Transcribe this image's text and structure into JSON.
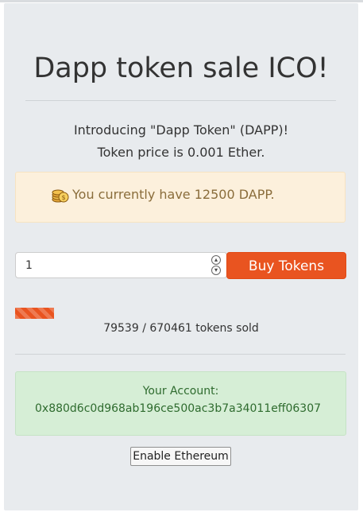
{
  "header": {
    "title": "Dapp token sale ICO!"
  },
  "intro": {
    "line1": "Introducing \"Dapp Token\" (DAPP)!",
    "line2": "Token price is 0.001 Ether."
  },
  "balance_alert": {
    "icon": "coins-icon",
    "text": "You currently have 12500 DAPP."
  },
  "purchase": {
    "quantity_value": "1",
    "buy_label": "Buy Tokens"
  },
  "progress": {
    "sold": 79539,
    "total": 670461,
    "fraction": 0.1186,
    "text": "79539 / 670461 tokens sold"
  },
  "account": {
    "label": "Your Account:",
    "address": "0x880d6c0d968ab196ce500ac3b7a34011eff06307"
  },
  "enable_button": {
    "label": "Enable Ethereum"
  },
  "colors": {
    "accent": "#e95420",
    "warning_bg": "#fcf0dc",
    "warning_text": "#8a6d3b",
    "success_bg": "#d6eed6",
    "success_text": "#2e6b2e",
    "panel_bg": "#e8ebee"
  }
}
